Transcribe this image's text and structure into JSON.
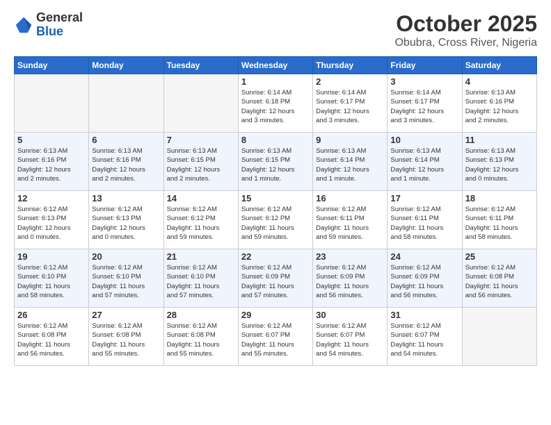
{
  "header": {
    "logo": {
      "general": "General",
      "blue": "Blue"
    },
    "title": "October 2025",
    "location": "Obubra, Cross River, Nigeria"
  },
  "weekdays": [
    "Sunday",
    "Monday",
    "Tuesday",
    "Wednesday",
    "Thursday",
    "Friday",
    "Saturday"
  ],
  "weeks": [
    [
      {
        "day": "",
        "info": ""
      },
      {
        "day": "",
        "info": ""
      },
      {
        "day": "",
        "info": ""
      },
      {
        "day": "1",
        "info": "Sunrise: 6:14 AM\nSunset: 6:18 PM\nDaylight: 12 hours\nand 3 minutes."
      },
      {
        "day": "2",
        "info": "Sunrise: 6:14 AM\nSunset: 6:17 PM\nDaylight: 12 hours\nand 3 minutes."
      },
      {
        "day": "3",
        "info": "Sunrise: 6:14 AM\nSunset: 6:17 PM\nDaylight: 12 hours\nand 3 minutes."
      },
      {
        "day": "4",
        "info": "Sunrise: 6:13 AM\nSunset: 6:16 PM\nDaylight: 12 hours\nand 2 minutes."
      }
    ],
    [
      {
        "day": "5",
        "info": "Sunrise: 6:13 AM\nSunset: 6:16 PM\nDaylight: 12 hours\nand 2 minutes."
      },
      {
        "day": "6",
        "info": "Sunrise: 6:13 AM\nSunset: 6:16 PM\nDaylight: 12 hours\nand 2 minutes."
      },
      {
        "day": "7",
        "info": "Sunrise: 6:13 AM\nSunset: 6:15 PM\nDaylight: 12 hours\nand 2 minutes."
      },
      {
        "day": "8",
        "info": "Sunrise: 6:13 AM\nSunset: 6:15 PM\nDaylight: 12 hours\nand 1 minute."
      },
      {
        "day": "9",
        "info": "Sunrise: 6:13 AM\nSunset: 6:14 PM\nDaylight: 12 hours\nand 1 minute."
      },
      {
        "day": "10",
        "info": "Sunrise: 6:13 AM\nSunset: 6:14 PM\nDaylight: 12 hours\nand 1 minute."
      },
      {
        "day": "11",
        "info": "Sunrise: 6:13 AM\nSunset: 6:13 PM\nDaylight: 12 hours\nand 0 minutes."
      }
    ],
    [
      {
        "day": "12",
        "info": "Sunrise: 6:12 AM\nSunset: 6:13 PM\nDaylight: 12 hours\nand 0 minutes."
      },
      {
        "day": "13",
        "info": "Sunrise: 6:12 AM\nSunset: 6:13 PM\nDaylight: 12 hours\nand 0 minutes."
      },
      {
        "day": "14",
        "info": "Sunrise: 6:12 AM\nSunset: 6:12 PM\nDaylight: 11 hours\nand 59 minutes."
      },
      {
        "day": "15",
        "info": "Sunrise: 6:12 AM\nSunset: 6:12 PM\nDaylight: 11 hours\nand 59 minutes."
      },
      {
        "day": "16",
        "info": "Sunrise: 6:12 AM\nSunset: 6:11 PM\nDaylight: 11 hours\nand 59 minutes."
      },
      {
        "day": "17",
        "info": "Sunrise: 6:12 AM\nSunset: 6:11 PM\nDaylight: 11 hours\nand 58 minutes."
      },
      {
        "day": "18",
        "info": "Sunrise: 6:12 AM\nSunset: 6:11 PM\nDaylight: 11 hours\nand 58 minutes."
      }
    ],
    [
      {
        "day": "19",
        "info": "Sunrise: 6:12 AM\nSunset: 6:10 PM\nDaylight: 11 hours\nand 58 minutes."
      },
      {
        "day": "20",
        "info": "Sunrise: 6:12 AM\nSunset: 6:10 PM\nDaylight: 11 hours\nand 57 minutes."
      },
      {
        "day": "21",
        "info": "Sunrise: 6:12 AM\nSunset: 6:10 PM\nDaylight: 11 hours\nand 57 minutes."
      },
      {
        "day": "22",
        "info": "Sunrise: 6:12 AM\nSunset: 6:09 PM\nDaylight: 11 hours\nand 57 minutes."
      },
      {
        "day": "23",
        "info": "Sunrise: 6:12 AM\nSunset: 6:09 PM\nDaylight: 11 hours\nand 56 minutes."
      },
      {
        "day": "24",
        "info": "Sunrise: 6:12 AM\nSunset: 6:09 PM\nDaylight: 11 hours\nand 56 minutes."
      },
      {
        "day": "25",
        "info": "Sunrise: 6:12 AM\nSunset: 6:08 PM\nDaylight: 11 hours\nand 56 minutes."
      }
    ],
    [
      {
        "day": "26",
        "info": "Sunrise: 6:12 AM\nSunset: 6:08 PM\nDaylight: 11 hours\nand 56 minutes."
      },
      {
        "day": "27",
        "info": "Sunrise: 6:12 AM\nSunset: 6:08 PM\nDaylight: 11 hours\nand 55 minutes."
      },
      {
        "day": "28",
        "info": "Sunrise: 6:12 AM\nSunset: 6:08 PM\nDaylight: 11 hours\nand 55 minutes."
      },
      {
        "day": "29",
        "info": "Sunrise: 6:12 AM\nSunset: 6:07 PM\nDaylight: 11 hours\nand 55 minutes."
      },
      {
        "day": "30",
        "info": "Sunrise: 6:12 AM\nSunset: 6:07 PM\nDaylight: 11 hours\nand 54 minutes."
      },
      {
        "day": "31",
        "info": "Sunrise: 6:12 AM\nSunset: 6:07 PM\nDaylight: 11 hours\nand 54 minutes."
      },
      {
        "day": "",
        "info": ""
      }
    ]
  ]
}
